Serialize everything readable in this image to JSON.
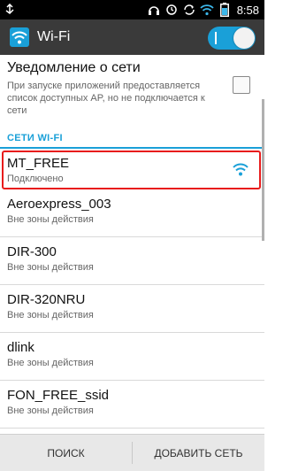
{
  "status_bar": {
    "time": "8:58",
    "icons": [
      "usb-icon",
      "headphones-icon",
      "alarm-icon",
      "sync-icon",
      "wifi-signal-icon",
      "battery-icon"
    ]
  },
  "action_bar": {
    "title": "Wi-Fi",
    "toggle_state": "on"
  },
  "notification": {
    "title": "Уведомление о сети",
    "description": "При запуске приложений предоставляется список доступных AP, но не подключается к сети",
    "checked": false
  },
  "section_header": "СЕТИ WI-FI",
  "networks": [
    {
      "name": "MT_FREE",
      "status": "Подключено"
    },
    {
      "name": "Aeroexpress_003",
      "status": "Вне зоны действия"
    },
    {
      "name": "DIR-300",
      "status": "Вне зоны действия"
    },
    {
      "name": "DIR-320NRU",
      "status": "Вне зоны действия"
    },
    {
      "name": "dlink",
      "status": "Вне зоны действия"
    },
    {
      "name": "FON_FREE_ssid",
      "status": "Вне зоны действия"
    }
  ],
  "bottom_bar": {
    "search_label": "ПОИСК",
    "add_network_label": "ДОБАВИТЬ СЕТЬ"
  },
  "colors": {
    "accent": "#1aa0d8",
    "highlight": "#e81c1c"
  }
}
